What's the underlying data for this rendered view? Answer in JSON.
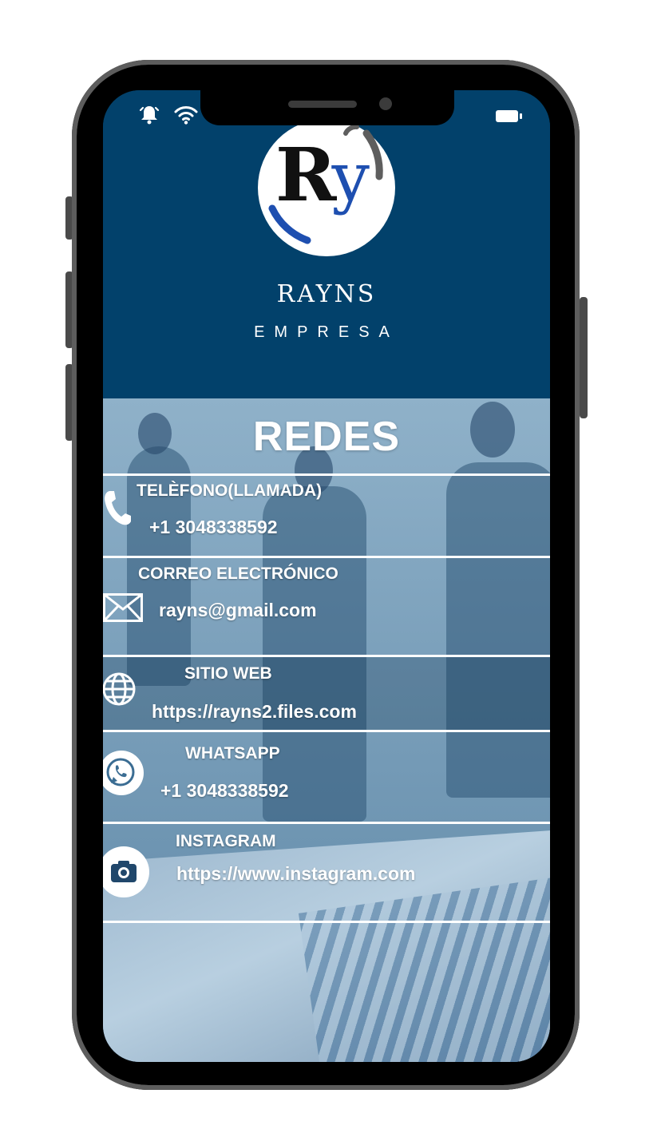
{
  "brand": {
    "logo_text": "Ry",
    "name": "RAYNS",
    "subtitle": "EMPRESA"
  },
  "section": {
    "title": "REDES"
  },
  "contacts": [
    {
      "label": "TELÈFONO(LLAMADA)",
      "value": "+1 3048338592",
      "icon": "phone-icon"
    },
    {
      "label": "CORREO ELECTRÓNICO",
      "value": "rayns@gmail.com",
      "icon": "mail-icon"
    },
    {
      "label": "SITIO WEB",
      "value": "https://rayns2.files.com",
      "icon": "globe-icon"
    },
    {
      "label": "WHATSAPP",
      "value": "+1 3048338592",
      "icon": "whatsapp-icon"
    },
    {
      "label": "INSTAGRAM",
      "value": "https://www.instagram.com",
      "icon": "camera-icon"
    }
  ],
  "colors": {
    "header_blue": "#02416b",
    "text": "#ffffff"
  }
}
